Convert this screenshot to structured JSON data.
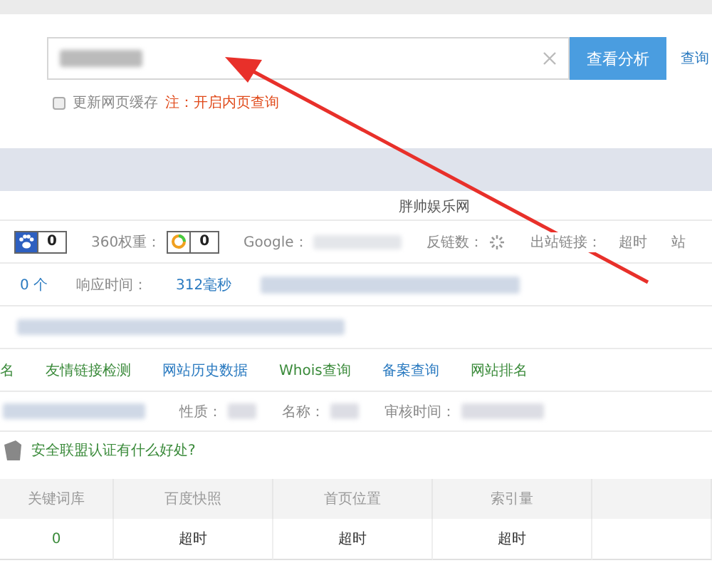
{
  "search": {
    "button": "查看分析",
    "link": "查询"
  },
  "options": {
    "checkbox": {
      "label": "更新网页缓存",
      "checked": false
    },
    "note": "注：开启内页查询"
  },
  "site_title": "胖帅娱乐网",
  "stats": [
    {
      "kind": "badge",
      "value": "0"
    },
    {
      "kind": "badge",
      "label": "360权重：",
      "value": "0"
    },
    {
      "kind": "redacted",
      "label": "Google："
    },
    {
      "kind": "spinner",
      "label": "反链数："
    },
    {
      "kind": "text",
      "label": "出站链接：",
      "value": "超时"
    },
    {
      "kind": "label",
      "label": "站"
    }
  ],
  "info": [
    {
      "kind": "value",
      "value": "0 个"
    },
    {
      "kind": "label",
      "label": "响应时间："
    },
    {
      "kind": "value",
      "value": "312毫秒"
    },
    {
      "kind": "redacted"
    }
  ],
  "links": [
    {
      "label": "名",
      "color": "#3a8a3a"
    },
    {
      "label": "友情链接检测",
      "color": "#3a8a3a"
    },
    {
      "label": "网站历史数据",
      "color": "#2a7ac0"
    },
    {
      "label": "Whois查询",
      "color": "#3a8a3a"
    },
    {
      "label": "备案查询",
      "color": "#2a7ac0"
    },
    {
      "label": "网站排名",
      "color": "#3a8a3a"
    }
  ],
  "record": [
    "性质：",
    "名称：",
    "审核时间："
  ],
  "security_link": "安全联盟认证有什么好处?",
  "table": {
    "columns": [
      "关键词库",
      "百度快照",
      "首页位置",
      "索引量"
    ],
    "rows": [
      [
        "0",
        "超时",
        "超时",
        "超时"
      ]
    ]
  }
}
